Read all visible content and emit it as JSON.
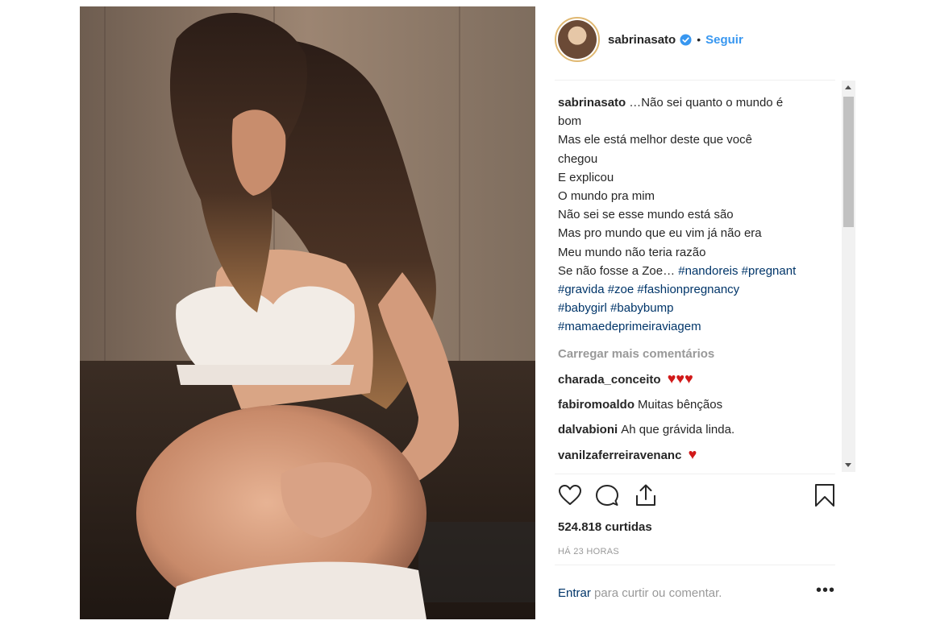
{
  "post": {
    "username": "sabrinasato",
    "follow_label": "Seguir",
    "separator": "•",
    "caption_lines": [
      "…Não sei quanto o mundo é",
      "bom",
      "Mas ele está melhor deste que você",
      "chegou",
      "E explicou",
      "O mundo pra mim",
      "Não sei se esse mundo está são",
      "Mas pro mundo que eu vim já não era",
      "Meu mundo não teria razão"
    ],
    "caption_last_prefix": "Se não fosse a Zoe… ",
    "hashtags": [
      "#nandoreis",
      "#pregnant",
      "#gravida",
      "#zoe",
      "#fashionpregnancy",
      "#babygirl",
      "#babybump",
      "#mamaedeprimeiraviagem"
    ],
    "load_more": "Carregar mais comentários",
    "comments": [
      {
        "user": "charada_conceito",
        "text": "",
        "hearts": 3
      },
      {
        "user": "fabiromoaldo",
        "text": "Muitas bênçãos",
        "hearts": 0
      },
      {
        "user": "dalvabioni",
        "text": "Ah que grávida linda.",
        "hearts": 0
      },
      {
        "user": "vanilzaferreiravenanc",
        "text": "",
        "hearts": 1
      }
    ],
    "likes": "524.818 curtidas",
    "time_ago": "HÁ 23 HORAS",
    "login_link": "Entrar",
    "login_rest": " para curtir ou comentar.",
    "more_options": "•••",
    "icons": {
      "like": "heart-outline-icon",
      "comment": "comment-bubble-icon",
      "share": "share-upload-icon",
      "save": "bookmark-icon",
      "verified": "verified-badge-icon"
    },
    "colors": {
      "link": "#3897f0",
      "hashtag": "#003569",
      "heart": "#d11919",
      "muted": "#999999"
    }
  }
}
